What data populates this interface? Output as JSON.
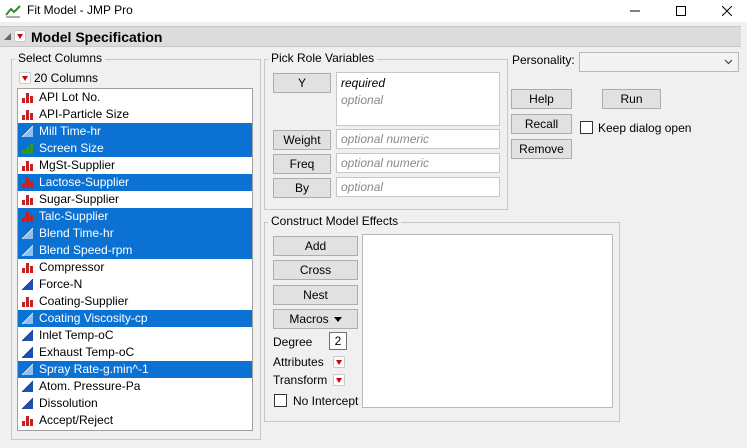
{
  "window": {
    "title": "Fit Model - JMP Pro"
  },
  "outline": {
    "title": "Model Specification"
  },
  "select_columns": {
    "label": "Select Columns",
    "count_label": "20 Columns",
    "items": [
      {
        "label": "API Lot No.",
        "icon": "nominal-icon",
        "selected": false
      },
      {
        "label": "API-Particle Size",
        "icon": "nominal-icon",
        "selected": false
      },
      {
        "label": "Mill Time-hr",
        "icon": "continuous-icon",
        "selected": true
      },
      {
        "label": "Screen Size",
        "icon": "ordinal-icon",
        "selected": true
      },
      {
        "label": "MgSt-Supplier",
        "icon": "nominal-icon",
        "selected": false
      },
      {
        "label": "Lactose-Supplier",
        "icon": "nominal-icon",
        "selected": true
      },
      {
        "label": "Sugar-Supplier",
        "icon": "nominal-icon",
        "selected": false
      },
      {
        "label": "Talc-Supplier",
        "icon": "nominal-icon",
        "selected": true
      },
      {
        "label": "Blend Time-hr",
        "icon": "continuous-icon",
        "selected": true
      },
      {
        "label": "Blend Speed-rpm",
        "icon": "continuous-icon",
        "selected": true
      },
      {
        "label": "Compressor",
        "icon": "nominal-icon",
        "selected": false
      },
      {
        "label": "Force-N",
        "icon": "continuous-icon",
        "selected": false
      },
      {
        "label": "Coating-Supplier",
        "icon": "nominal-icon",
        "selected": false
      },
      {
        "label": "Coating Viscosity-cp",
        "icon": "continuous-icon",
        "selected": true
      },
      {
        "label": "Inlet Temp-oC",
        "icon": "continuous-icon",
        "selected": false
      },
      {
        "label": "Exhaust Temp-oC",
        "icon": "continuous-icon",
        "selected": false
      },
      {
        "label": "Spray Rate-g.min^-1",
        "icon": "continuous-icon",
        "selected": true
      },
      {
        "label": "Atom. Pressure-Pa",
        "icon": "continuous-icon",
        "selected": false
      },
      {
        "label": "Dissolution",
        "icon": "continuous-icon",
        "selected": false
      },
      {
        "label": "Accept/Reject",
        "icon": "nominal-icon",
        "selected": false
      }
    ]
  },
  "pick_roles": {
    "label": "Pick Role Variables",
    "y_label": "Y",
    "y_required": "required",
    "y_optional": "optional",
    "weight_label": "Weight",
    "weight_placeholder": "optional numeric",
    "freq_label": "Freq",
    "freq_placeholder": "optional numeric",
    "by_label": "By",
    "by_placeholder": "optional"
  },
  "personality": {
    "label": "Personality:",
    "value": ""
  },
  "actions": {
    "help": "Help",
    "run": "Run",
    "recall": "Recall",
    "remove": "Remove",
    "keep_open": "Keep dialog open"
  },
  "construct": {
    "label": "Construct Model Effects",
    "add": "Add",
    "cross": "Cross",
    "nest": "Nest",
    "macros": "Macros",
    "degree_label": "Degree",
    "degree_value": "2",
    "attributes_label": "Attributes",
    "transform_label": "Transform",
    "no_intercept": "No Intercept"
  },
  "colors": {
    "selection": "#0b72d3",
    "nominal_red": "#c62020",
    "continuous_blue": "#1f4fb5",
    "ordinal_green": "#2e9a2e",
    "dropdown_red": "#d40000"
  }
}
